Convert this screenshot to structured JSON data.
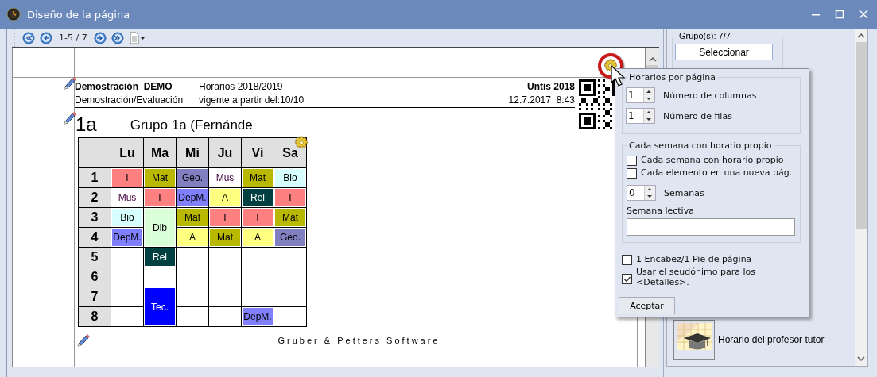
{
  "window": {
    "title": "Diseño de la página"
  },
  "toolbar": {
    "page_range": "1-5 / 7"
  },
  "report": {
    "school": "Demostración  DEMO",
    "subtitle": "Demostración/Evaluación",
    "timetable_year": "Horarios 2018/2019",
    "valid_from": "vigente a partir del:10/10",
    "product": "Untis 2018",
    "printed": "12.7.2017  8:43",
    "class_short": "1a",
    "class_title": "Grupo 1a (Fernánde",
    "footer": "Gruber & Petters Software"
  },
  "timetable": {
    "days": [
      "Lu",
      "Ma",
      "Mi",
      "Ju",
      "Vi",
      "Sa"
    ],
    "rows": [
      {
        "period": "1",
        "cells": [
          {
            "kind": "lesson",
            "text": "I",
            "color": "#ff8080"
          },
          {
            "kind": "lesson",
            "text": "Mat",
            "color": "#b8b800"
          },
          {
            "kind": "lesson",
            "text": "Geo.",
            "color": "#8080c0"
          },
          {
            "kind": "lesson",
            "text": "Mus",
            "color": "#ffffff"
          },
          {
            "kind": "lesson",
            "text": "Mat",
            "color": "#b8b800"
          },
          {
            "kind": "lesson",
            "text": "Bio",
            "color": "#d8ffff"
          }
        ]
      },
      {
        "period": "2",
        "cells": [
          {
            "kind": "lesson",
            "text": "Mus",
            "color": "#ffffff"
          },
          {
            "kind": "lesson",
            "text": "I",
            "color": "#ff8080"
          },
          {
            "kind": "lesson",
            "text": "DepM.",
            "color": "#8080ff"
          },
          {
            "kind": "lesson",
            "text": "A",
            "color": "#ffff80"
          },
          {
            "kind": "lesson",
            "text": "Rel",
            "color": "#004040"
          },
          {
            "kind": "lesson",
            "text": "I",
            "color": "#ff8080"
          }
        ]
      },
      {
        "period": "3",
        "cells": [
          {
            "kind": "lesson",
            "text": "Bio",
            "color": "#d8ffff"
          },
          {
            "kind": "double",
            "text": "Dib",
            "color": "#d8ffd8"
          },
          {
            "kind": "lesson",
            "text": "Mat",
            "color": "#b8b800"
          },
          {
            "kind": "lesson",
            "text": "I",
            "color": "#ff8080"
          },
          {
            "kind": "lesson",
            "text": "I",
            "color": "#ff8080"
          },
          {
            "kind": "lesson",
            "text": "Mat",
            "color": "#b8b800"
          }
        ]
      },
      {
        "period": "4",
        "cells": [
          {
            "kind": "lesson",
            "text": "DepM.",
            "color": "#8080ff"
          },
          {
            "kind": "covered"
          },
          {
            "kind": "lesson",
            "text": "A",
            "color": "#ffff80"
          },
          {
            "kind": "lesson",
            "text": "Mat",
            "color": "#b8b800"
          },
          {
            "kind": "lesson",
            "text": "A",
            "color": "#ffff80"
          },
          {
            "kind": "lesson",
            "text": "Geo.",
            "color": "#8080c0"
          }
        ]
      },
      {
        "period": "5",
        "cells": [
          {
            "kind": "empty"
          },
          {
            "kind": "lesson",
            "text": "Rel",
            "color": "#004040"
          },
          {
            "kind": "empty"
          },
          {
            "kind": "empty"
          },
          {
            "kind": "empty"
          },
          {
            "kind": "empty"
          }
        ]
      },
      {
        "period": "6",
        "cells": [
          {
            "kind": "empty"
          },
          {
            "kind": "empty"
          },
          {
            "kind": "empty"
          },
          {
            "kind": "empty"
          },
          {
            "kind": "empty"
          },
          {
            "kind": "empty"
          }
        ]
      },
      {
        "period": "7",
        "cells": [
          {
            "kind": "empty"
          },
          {
            "kind": "double",
            "text": "Tec.",
            "color": "#0000ff"
          },
          {
            "kind": "empty"
          },
          {
            "kind": "empty"
          },
          {
            "kind": "empty"
          },
          {
            "kind": "empty"
          }
        ]
      },
      {
        "period": "8",
        "cells": [
          {
            "kind": "empty"
          },
          {
            "kind": "covered"
          },
          {
            "kind": "empty"
          },
          {
            "kind": "empty"
          },
          {
            "kind": "lesson",
            "text": "DepM.",
            "color": "#8080ff"
          },
          {
            "kind": "empty"
          }
        ]
      }
    ]
  },
  "sidebar": {
    "group_label": "Grupo(s): 7/7",
    "select_button": "Seleccionar",
    "item": "Horario del profesor tutor"
  },
  "popup": {
    "per_page_title": "Horarios por página",
    "spinners": [
      {
        "value": "1",
        "label": "Número de columnas"
      },
      {
        "value": "1",
        "label": "Número de filas"
      }
    ],
    "week_title": "Cada semana con horario propio",
    "week_checks": [
      {
        "label": "Cada semana con horario propio",
        "checked": false
      },
      {
        "label": "Cada elemento en una nueva pág.",
        "checked": false
      }
    ],
    "weeks_spinner": {
      "value": "0",
      "label": "Semanas"
    },
    "teaching_week_label": "Semana lectiva",
    "checks": [
      {
        "label": "1 Encabez/1 Pie de página",
        "checked": false
      },
      {
        "label": "Usar el seudónimo para los <Detalles>.",
        "checked": true
      }
    ],
    "accept_button": "Aceptar"
  }
}
